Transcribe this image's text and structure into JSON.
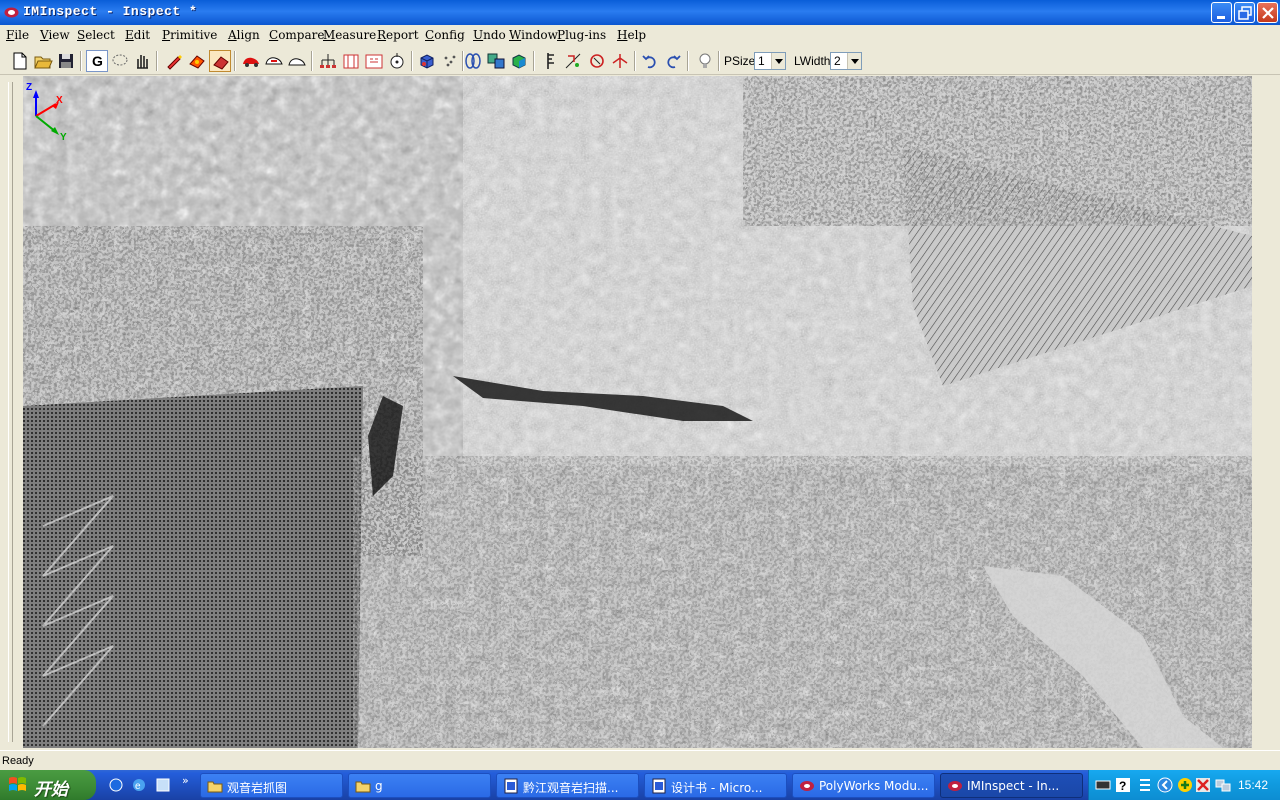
{
  "window": {
    "title": "IMInspect - Inspect *",
    "buttons": {
      "minimize": "minimize",
      "maximize": "maximize",
      "close": "close"
    }
  },
  "menu": {
    "items": [
      "File",
      "View",
      "Select",
      "Edit",
      "Primitive",
      "Align",
      "Compare",
      "Measure",
      "Report",
      "Config",
      "Undo",
      "Window",
      "Plug-ins",
      "Help"
    ]
  },
  "toolbar": {
    "psize_label": "PSize",
    "psize_value": "1",
    "lwidth_label": "LWidth",
    "lwidth_value": "2",
    "g_button": "G",
    "icons": [
      "new-file-icon",
      "open-folder-icon",
      "save-icon",
      "g-mode-icon",
      "lasso-icon",
      "pan-hand-icon",
      "marker-icon",
      "shape-icon",
      "shape-icon-2",
      "red-car-icon",
      "car-outline-icon",
      "car-outline-icon-2",
      "tree-icon",
      "column-icon",
      "column-icon-2",
      "target-icon",
      "cube-icon",
      "points-icon",
      "cylinders-icon",
      "compare-icon",
      "colored-cube-icon",
      "measure-icon",
      "fit-icon",
      "rotate-icon",
      "arrows-icon",
      "undo-icon",
      "redo-icon",
      "bulb-icon"
    ]
  },
  "viewport": {
    "axis": {
      "x": "X",
      "y": "Y",
      "z": "Z"
    },
    "colors": {
      "x": "#ff0000",
      "y": "#00aa00",
      "z": "#0000ff"
    }
  },
  "status": {
    "text": "Ready"
  },
  "taskbar": {
    "start_label": "开始",
    "tasks": [
      {
        "label": "观音岩抓图",
        "icon": "folder-icon"
      },
      {
        "label": "g",
        "icon": "folder-icon"
      },
      {
        "label": "黔江观音岩扫描...",
        "icon": "document-icon"
      },
      {
        "label": "设计书 - Micro...",
        "icon": "document-icon"
      },
      {
        "label": "PolyWorks Modu...",
        "icon": "polyworks-icon"
      },
      {
        "label": "IMInspect - In...",
        "icon": "polyworks-icon"
      }
    ],
    "active_task": 5,
    "clock": "15:42"
  }
}
